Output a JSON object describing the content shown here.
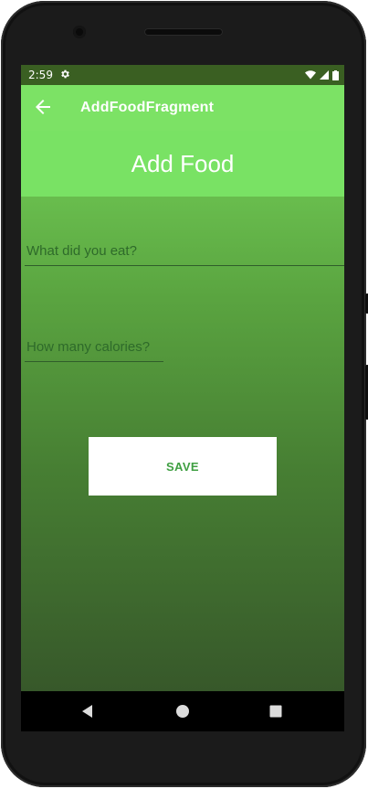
{
  "status_bar": {
    "time": "2:59",
    "settings_icon": "gear-icon",
    "wifi_icon": "wifi-icon",
    "signal_icon": "signal-icon",
    "battery_icon": "battery-icon"
  },
  "app_bar": {
    "back_icon": "arrow-left-icon",
    "title": "AddFoodFragment",
    "color": "#7ce265"
  },
  "main": {
    "heading": "Add Food",
    "food_input": {
      "placeholder": "What did you eat?",
      "value": ""
    },
    "calories_input": {
      "placeholder": "How many calories?",
      "value": ""
    },
    "save_button": {
      "label": "SAVE"
    },
    "gradient_top": "#72cd56",
    "gradient_bottom": "#37582a"
  },
  "nav_bar": {
    "back_icon": "triangle-back-icon",
    "home_icon": "circle-home-icon",
    "recents_icon": "square-recents-icon"
  }
}
